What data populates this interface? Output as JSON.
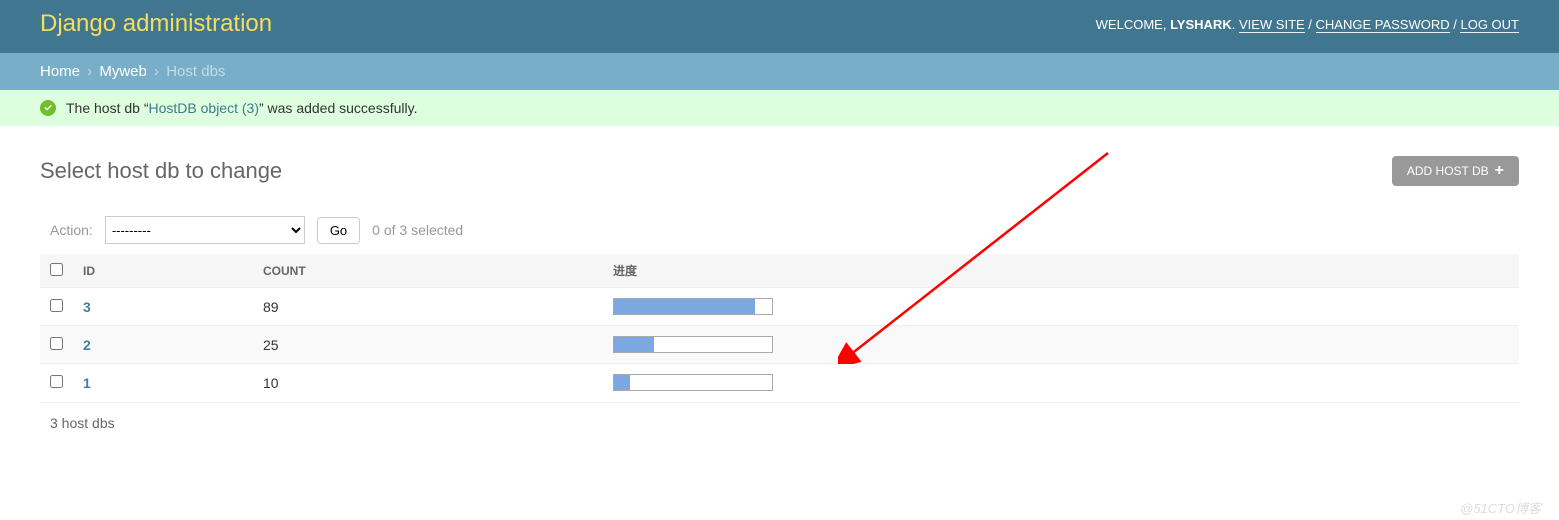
{
  "header": {
    "site_name": "Django administration",
    "welcome": "WELCOME, ",
    "username": "LYSHARK",
    "view_site": "VIEW SITE",
    "change_password": "CHANGE PASSWORD",
    "logout": "LOG OUT",
    "sep": " / "
  },
  "breadcrumbs": {
    "home": "Home",
    "app": "Myweb",
    "model": "Host dbs",
    "sep": " › "
  },
  "message": {
    "prefix": "The host db “",
    "obj_link": "HostDB object (3)",
    "suffix": "” was added successfully."
  },
  "page": {
    "title": "Select host db to change",
    "add_button": "ADD HOST DB"
  },
  "actions": {
    "label": "Action:",
    "blank_option": "---------",
    "go": "Go",
    "counter": "0 of 3 selected"
  },
  "columns": {
    "id": "ID",
    "count": "COUNT",
    "progress": "进度"
  },
  "rows": [
    {
      "id": "3",
      "count": "89",
      "progress": 89
    },
    {
      "id": "2",
      "count": "25",
      "progress": 25
    },
    {
      "id": "1",
      "count": "10",
      "progress": 10
    }
  ],
  "paginator": {
    "summary": "3 host dbs"
  },
  "watermark": "@51CTO博客",
  "annotation": {
    "arrow_color": "#ff0000"
  }
}
